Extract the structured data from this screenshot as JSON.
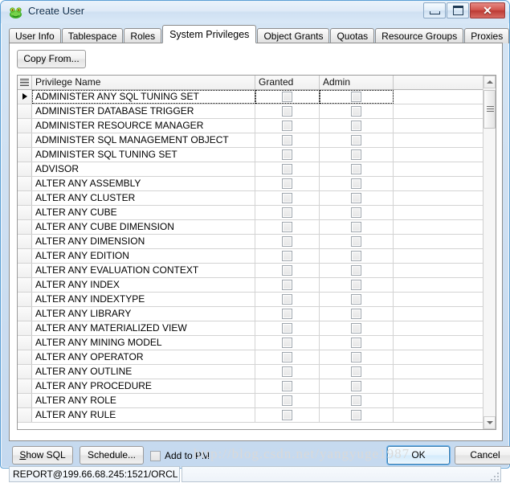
{
  "window": {
    "title": "Create User",
    "icon": "toad-frog-icon",
    "controls": {
      "minimize": "Minimize",
      "restore": "Restore",
      "close": "Close"
    },
    "close_glyph": "✕"
  },
  "tabs": [
    {
      "label": "User Info",
      "active": false
    },
    {
      "label": "Tablespace",
      "active": false
    },
    {
      "label": "Roles",
      "active": false
    },
    {
      "label": "System Privileges",
      "active": true
    },
    {
      "label": "Object Grants",
      "active": false
    },
    {
      "label": "Quotas",
      "active": false
    },
    {
      "label": "Resource Groups",
      "active": false
    },
    {
      "label": "Proxies",
      "active": false
    }
  ],
  "toolbar": {
    "copy_from_label": "Copy From..."
  },
  "grid": {
    "columns": [
      {
        "key": "name",
        "label": "Privilege Name"
      },
      {
        "key": "granted",
        "label": "Granted"
      },
      {
        "key": "admin",
        "label": "Admin"
      }
    ],
    "current_row_index": 0,
    "rows": [
      {
        "name": "ADMINISTER ANY SQL TUNING SET",
        "granted": false,
        "admin": false
      },
      {
        "name": "ADMINISTER DATABASE TRIGGER",
        "granted": false,
        "admin": false
      },
      {
        "name": "ADMINISTER RESOURCE MANAGER",
        "granted": false,
        "admin": false
      },
      {
        "name": "ADMINISTER SQL MANAGEMENT OBJECT",
        "granted": false,
        "admin": false
      },
      {
        "name": "ADMINISTER SQL TUNING SET",
        "granted": false,
        "admin": false
      },
      {
        "name": "ADVISOR",
        "granted": false,
        "admin": false
      },
      {
        "name": "ALTER ANY ASSEMBLY",
        "granted": false,
        "admin": false
      },
      {
        "name": "ALTER ANY CLUSTER",
        "granted": false,
        "admin": false
      },
      {
        "name": "ALTER ANY CUBE",
        "granted": false,
        "admin": false
      },
      {
        "name": "ALTER ANY CUBE DIMENSION",
        "granted": false,
        "admin": false
      },
      {
        "name": "ALTER ANY DIMENSION",
        "granted": false,
        "admin": false
      },
      {
        "name": "ALTER ANY EDITION",
        "granted": false,
        "admin": false
      },
      {
        "name": "ALTER ANY EVALUATION CONTEXT",
        "granted": false,
        "admin": false
      },
      {
        "name": "ALTER ANY INDEX",
        "granted": false,
        "admin": false
      },
      {
        "name": "ALTER ANY INDEXTYPE",
        "granted": false,
        "admin": false
      },
      {
        "name": "ALTER ANY LIBRARY",
        "granted": false,
        "admin": false
      },
      {
        "name": "ALTER ANY MATERIALIZED VIEW",
        "granted": false,
        "admin": false
      },
      {
        "name": "ALTER ANY MINING MODEL",
        "granted": false,
        "admin": false
      },
      {
        "name": "ALTER ANY OPERATOR",
        "granted": false,
        "admin": false
      },
      {
        "name": "ALTER ANY OUTLINE",
        "granted": false,
        "admin": false
      },
      {
        "name": "ALTER ANY PROCEDURE",
        "granted": false,
        "admin": false
      },
      {
        "name": "ALTER ANY ROLE",
        "granted": false,
        "admin": false
      },
      {
        "name": "ALTER ANY RULE",
        "granted": false,
        "admin": false
      }
    ]
  },
  "footer": {
    "show_sql": {
      "accesskey": "S",
      "rest": "how SQL"
    },
    "schedule_label": "Schedule...",
    "add_to_pm_label": "Add to PM",
    "add_to_pm_checked": false,
    "ok_label": "OK",
    "cancel_label": "Cancel"
  },
  "statusbar": {
    "connection": "REPORT@199.66.68.245:1521/ORCL",
    "secondary": ""
  },
  "watermark": {
    "text": "http://blog.csdn.net/yangyuge1987"
  },
  "colors": {
    "frame": "#5b9fd4",
    "close_button": "#bb3a34",
    "default_button_focus": "#6ab0e8",
    "grid_line": "#d3d3d3"
  }
}
